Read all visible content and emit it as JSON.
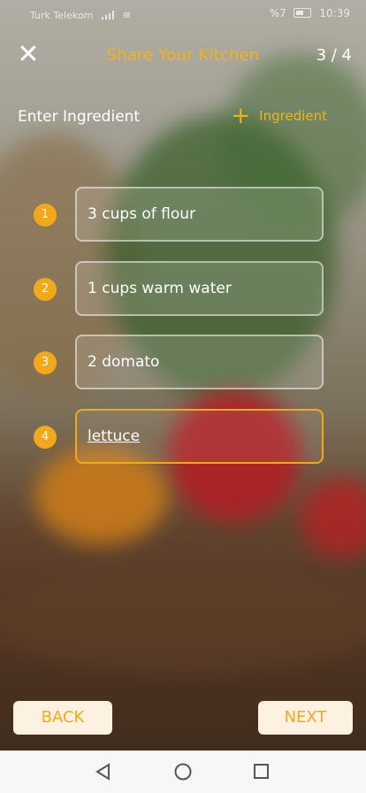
{
  "status_bar": {
    "carrier": "Turk Telekom",
    "battery": "%7",
    "time": "10:39"
  },
  "header": {
    "close_glyph": "✕",
    "title": "Share Your Kitchen",
    "step": "3 / 4"
  },
  "section": {
    "label": "Enter Ingredient",
    "add_label": "Ingredient"
  },
  "ingredients": [
    {
      "num": "1",
      "text": "3 cups of flour"
    },
    {
      "num": "2",
      "text": "1 cups warm water"
    },
    {
      "num": "3",
      "text": "2 domato"
    },
    {
      "num": "4",
      "text": "lettuce"
    }
  ],
  "buttons": {
    "back": "BACK",
    "next": "NEXT"
  },
  "colors": {
    "accent": "#f2a81b",
    "title": "#f2b21b"
  },
  "nav_icons": [
    "back-triangle-icon",
    "home-circle-icon",
    "recents-square-icon"
  ]
}
